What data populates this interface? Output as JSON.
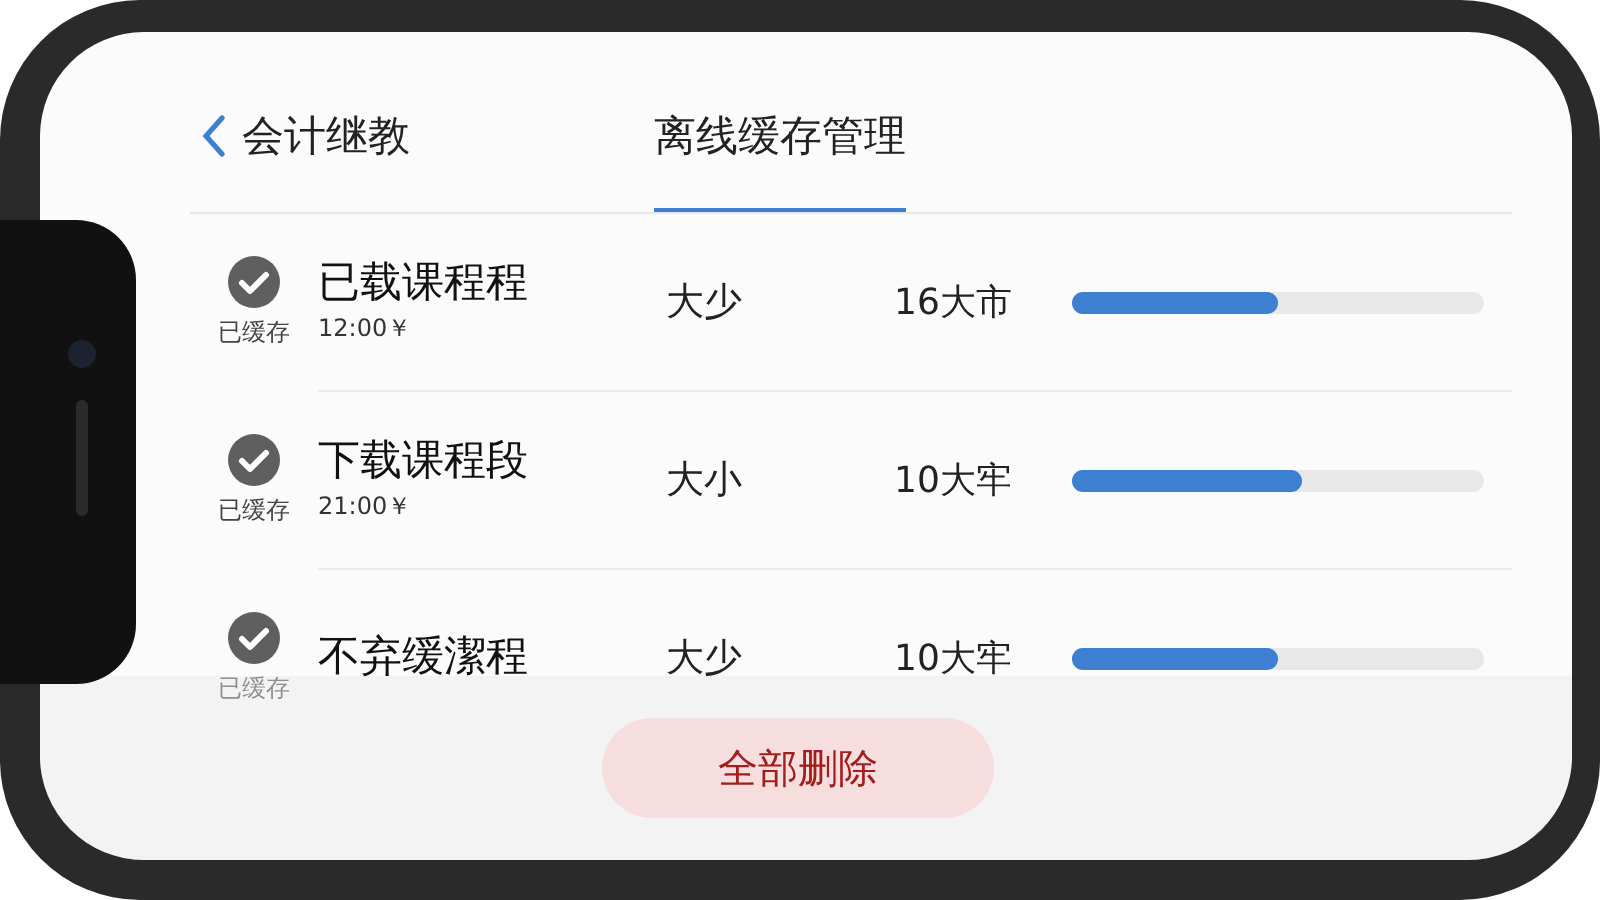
{
  "header": {
    "back_label": "会计继教",
    "title": "离线缓存管理"
  },
  "items": [
    {
      "status": "已缓存",
      "cached": true,
      "name": "已载课程程",
      "time": "12:00￥",
      "size_label": "大少",
      "size": "16大市",
      "level": 0.5
    },
    {
      "status": "已缓存",
      "cached": true,
      "name": "下载课程段",
      "time": "21:00￥",
      "size_label": "大小",
      "size": "10大牢",
      "level": 0.56
    },
    {
      "status": "已缓存",
      "cached": true,
      "name": "不弃缓潔程",
      "size_label": "大少",
      "size": "10大牢",
      "level": 0.5
    }
  ],
  "footer": {
    "button": "全部删除"
  }
}
